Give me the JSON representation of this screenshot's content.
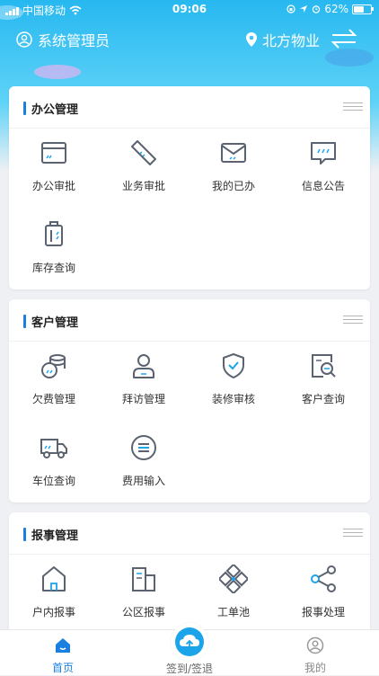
{
  "status_bar": {
    "carrier": "中国移动",
    "time": "09:06",
    "battery": "62%",
    "battery_level": 0.62
  },
  "header": {
    "user_name": "系统管理员",
    "location": "北方物业"
  },
  "sections": [
    {
      "title": "办公管理",
      "items": [
        {
          "label": "办公审批",
          "icon": "card-icon"
        },
        {
          "label": "业务审批",
          "icon": "ticket-icon"
        },
        {
          "label": "我的已办",
          "icon": "mail-icon"
        },
        {
          "label": "信息公告",
          "icon": "message-icon"
        },
        {
          "label": "库存查询",
          "icon": "luggage-icon"
        }
      ]
    },
    {
      "title": "客户管理",
      "items": [
        {
          "label": "欠费管理",
          "icon": "coins-icon"
        },
        {
          "label": "拜访管理",
          "icon": "person-icon"
        },
        {
          "label": "装修审核",
          "icon": "shield-check-icon"
        },
        {
          "label": "客户查询",
          "icon": "search-doc-icon"
        },
        {
          "label": "车位查询",
          "icon": "truck-icon"
        },
        {
          "label": "费用输入",
          "icon": "list-circle-icon"
        }
      ]
    },
    {
      "title": "报事管理",
      "items": [
        {
          "label": "户内报事",
          "icon": "house-icon"
        },
        {
          "label": "公区报事",
          "icon": "buildings-icon"
        },
        {
          "label": "工单池",
          "icon": "network-icon"
        },
        {
          "label": "报事处理",
          "icon": "share-icon"
        }
      ]
    }
  ],
  "tabs": {
    "home": "首页",
    "checkin": "签到/签退",
    "mine": "我的"
  },
  "colors": {
    "accent": "#1b7fe0",
    "header": "#27b8f0"
  }
}
